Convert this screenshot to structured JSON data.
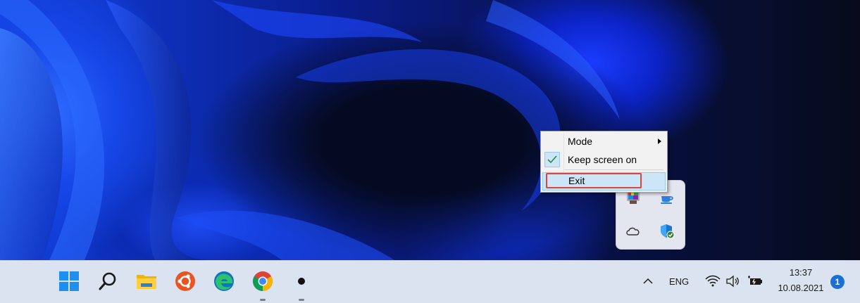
{
  "context_menu": {
    "items": [
      {
        "label": "Mode",
        "has_submenu": true
      },
      {
        "label": "Keep screen on",
        "checked": true
      },
      {
        "label": "Exit",
        "highlighted": true
      }
    ]
  },
  "taskbar": {
    "apps": [
      {
        "name": "start",
        "icon": "windows-logo-icon"
      },
      {
        "name": "search",
        "icon": "search-icon"
      },
      {
        "name": "file-explorer",
        "icon": "folder-icon"
      },
      {
        "name": "ubuntu",
        "icon": "ubuntu-icon"
      },
      {
        "name": "edge",
        "icon": "edge-icon"
      },
      {
        "name": "chrome",
        "icon": "chrome-icon"
      },
      {
        "name": "app",
        "icon": "dot-app-icon"
      }
    ],
    "tray": {
      "language": "ENG",
      "time": "13:37",
      "date": "10.08.2021",
      "notification_count": "1"
    }
  },
  "tray_flyout": {
    "icons": [
      "paint-icon",
      "coffee-cup-icon",
      "onedrive-cloud-icon",
      "defender-shield-icon"
    ]
  },
  "colors": {
    "accent": "#1a6fd6",
    "menu_highlight": "#cde6f7",
    "highlight_outline": "#e0443e",
    "taskbar": "#dce3f0"
  }
}
